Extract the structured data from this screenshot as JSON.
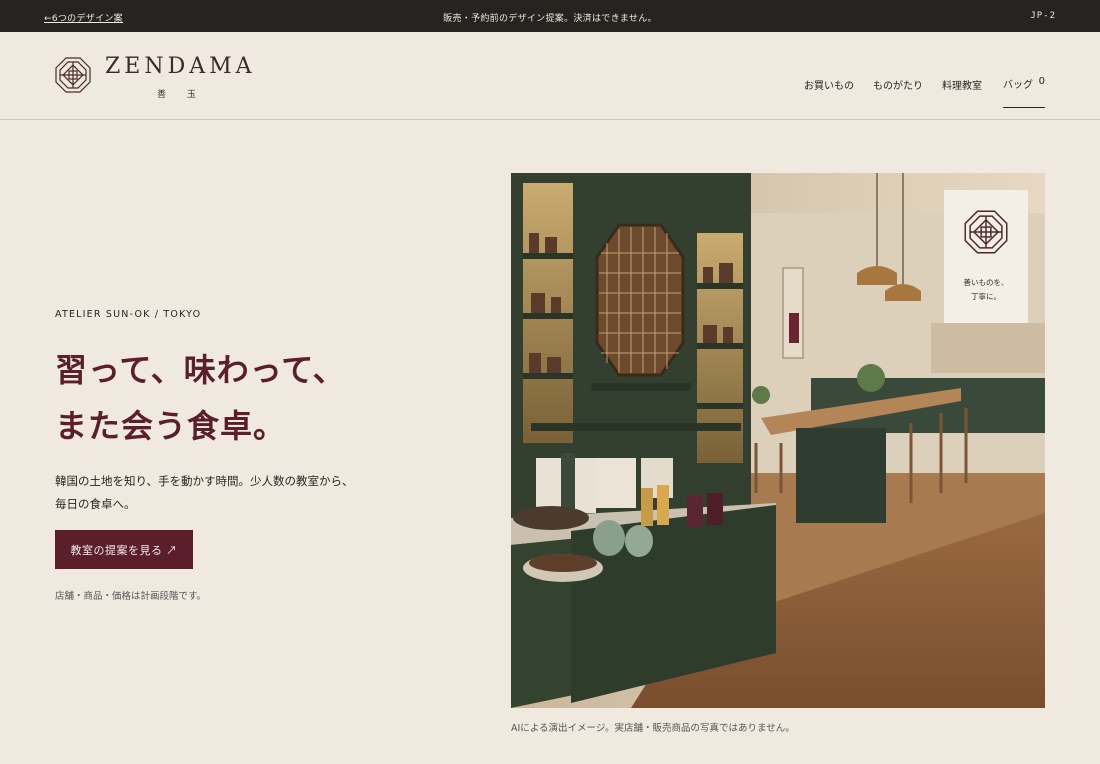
{
  "topbar": {
    "back_link": "←6つのデザイン案",
    "notice": "販売・予約前のデザイン提案。決済はできません。",
    "code": "JP-2"
  },
  "header": {
    "brand": "ZENDAMA",
    "brand_sub": "善 玉",
    "nav": [
      "お買いもの",
      "ものがたり",
      "料理教室"
    ],
    "bag_label": "バッグ",
    "bag_count": "0"
  },
  "hero": {
    "eyebrow": "ATELIER SUN-OK / TOKYO",
    "headline_line1": "習って、味わって、",
    "headline_line2": "また会う食卓。",
    "lead_line1": "韓国の土地を知り、手を動かす時間。少人数の教室から、",
    "lead_line2": "毎日の食卓へ。",
    "cta_label": "教室の提案を見る ↗",
    "note": "店舗・商品・価格は計画段階です。",
    "caption": "AIによる演出イメージ。実店舗・販売商品の写真ではありません。",
    "badge_line1": "善いものを、",
    "badge_line2": "丁寧に。"
  },
  "colors": {
    "accent": "#5a1f2a",
    "background": "#efe9df",
    "topbar": "#252420"
  }
}
